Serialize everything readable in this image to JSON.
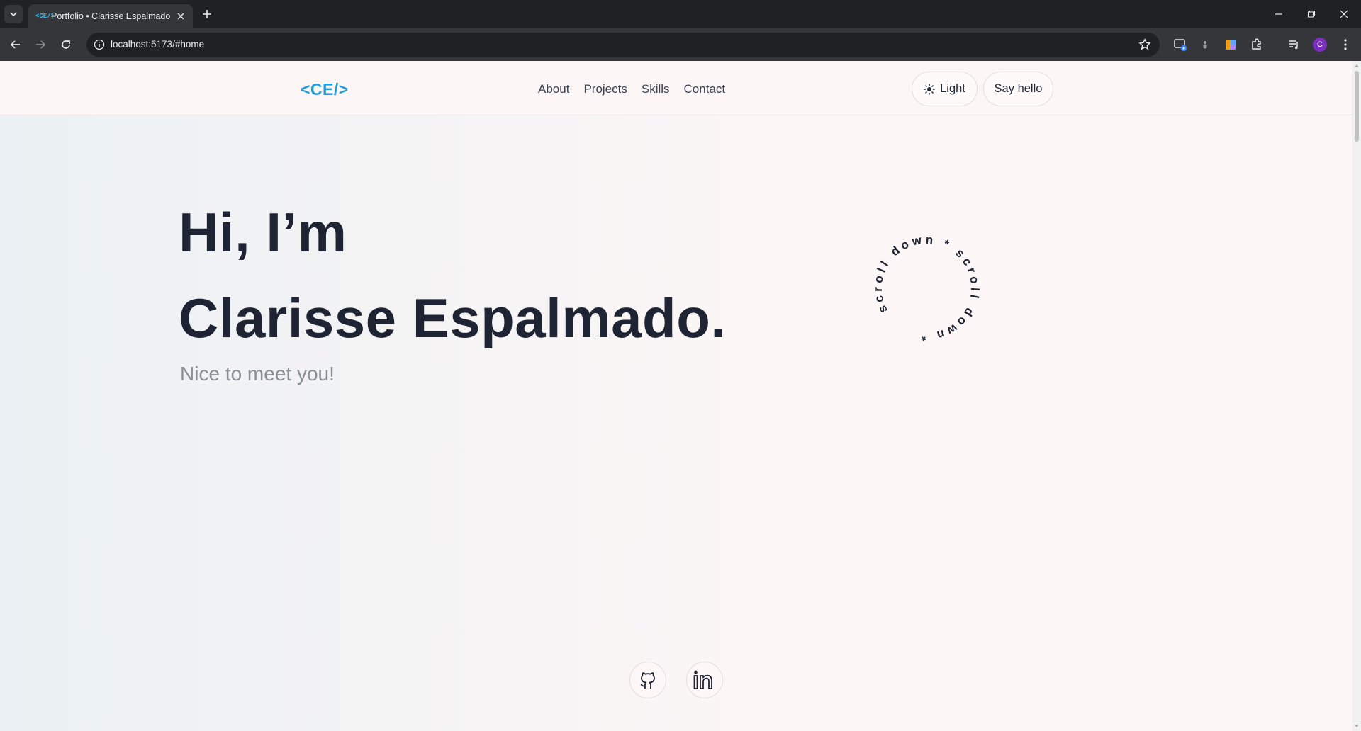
{
  "browser": {
    "tab_title": "Portfolio • Clarisse Espalmado",
    "tab_favicon": "<CE/>",
    "url": "localhost:5173/#home",
    "profile_initial": "C"
  },
  "site": {
    "logo": "<CE/>",
    "nav": [
      "About",
      "Projects",
      "Skills",
      "Contact"
    ],
    "theme_label": "Light",
    "cta_label": "Say hello"
  },
  "hero": {
    "line1": "Hi, I’m",
    "line2": "Clarisse Espalmado.",
    "subtitle": "Nice to meet you!",
    "badge_text": "scroll down * scroll down * "
  },
  "social": {
    "icons": [
      "github-icon",
      "linkedin-icon"
    ]
  },
  "colors": {
    "accent": "#1f9ede",
    "heading": "#1e2433",
    "muted": "#8a8e96",
    "chrome_dark": "#202124",
    "chrome_mid": "#35363a"
  }
}
